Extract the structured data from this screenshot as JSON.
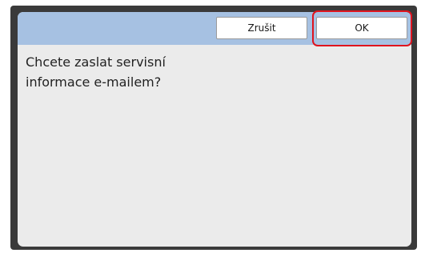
{
  "dialog": {
    "message_lines": [
      "Chcete zaslat servisní",
      "informace e-mailem?"
    ],
    "cancel_label": "Zrušit",
    "ok_label": "OK"
  },
  "colors": {
    "header_bar": "#a6c1e2",
    "screen_background": "#ebebeb",
    "bezel": "#3a3a3a",
    "highlight_frame": "#e0141e"
  }
}
